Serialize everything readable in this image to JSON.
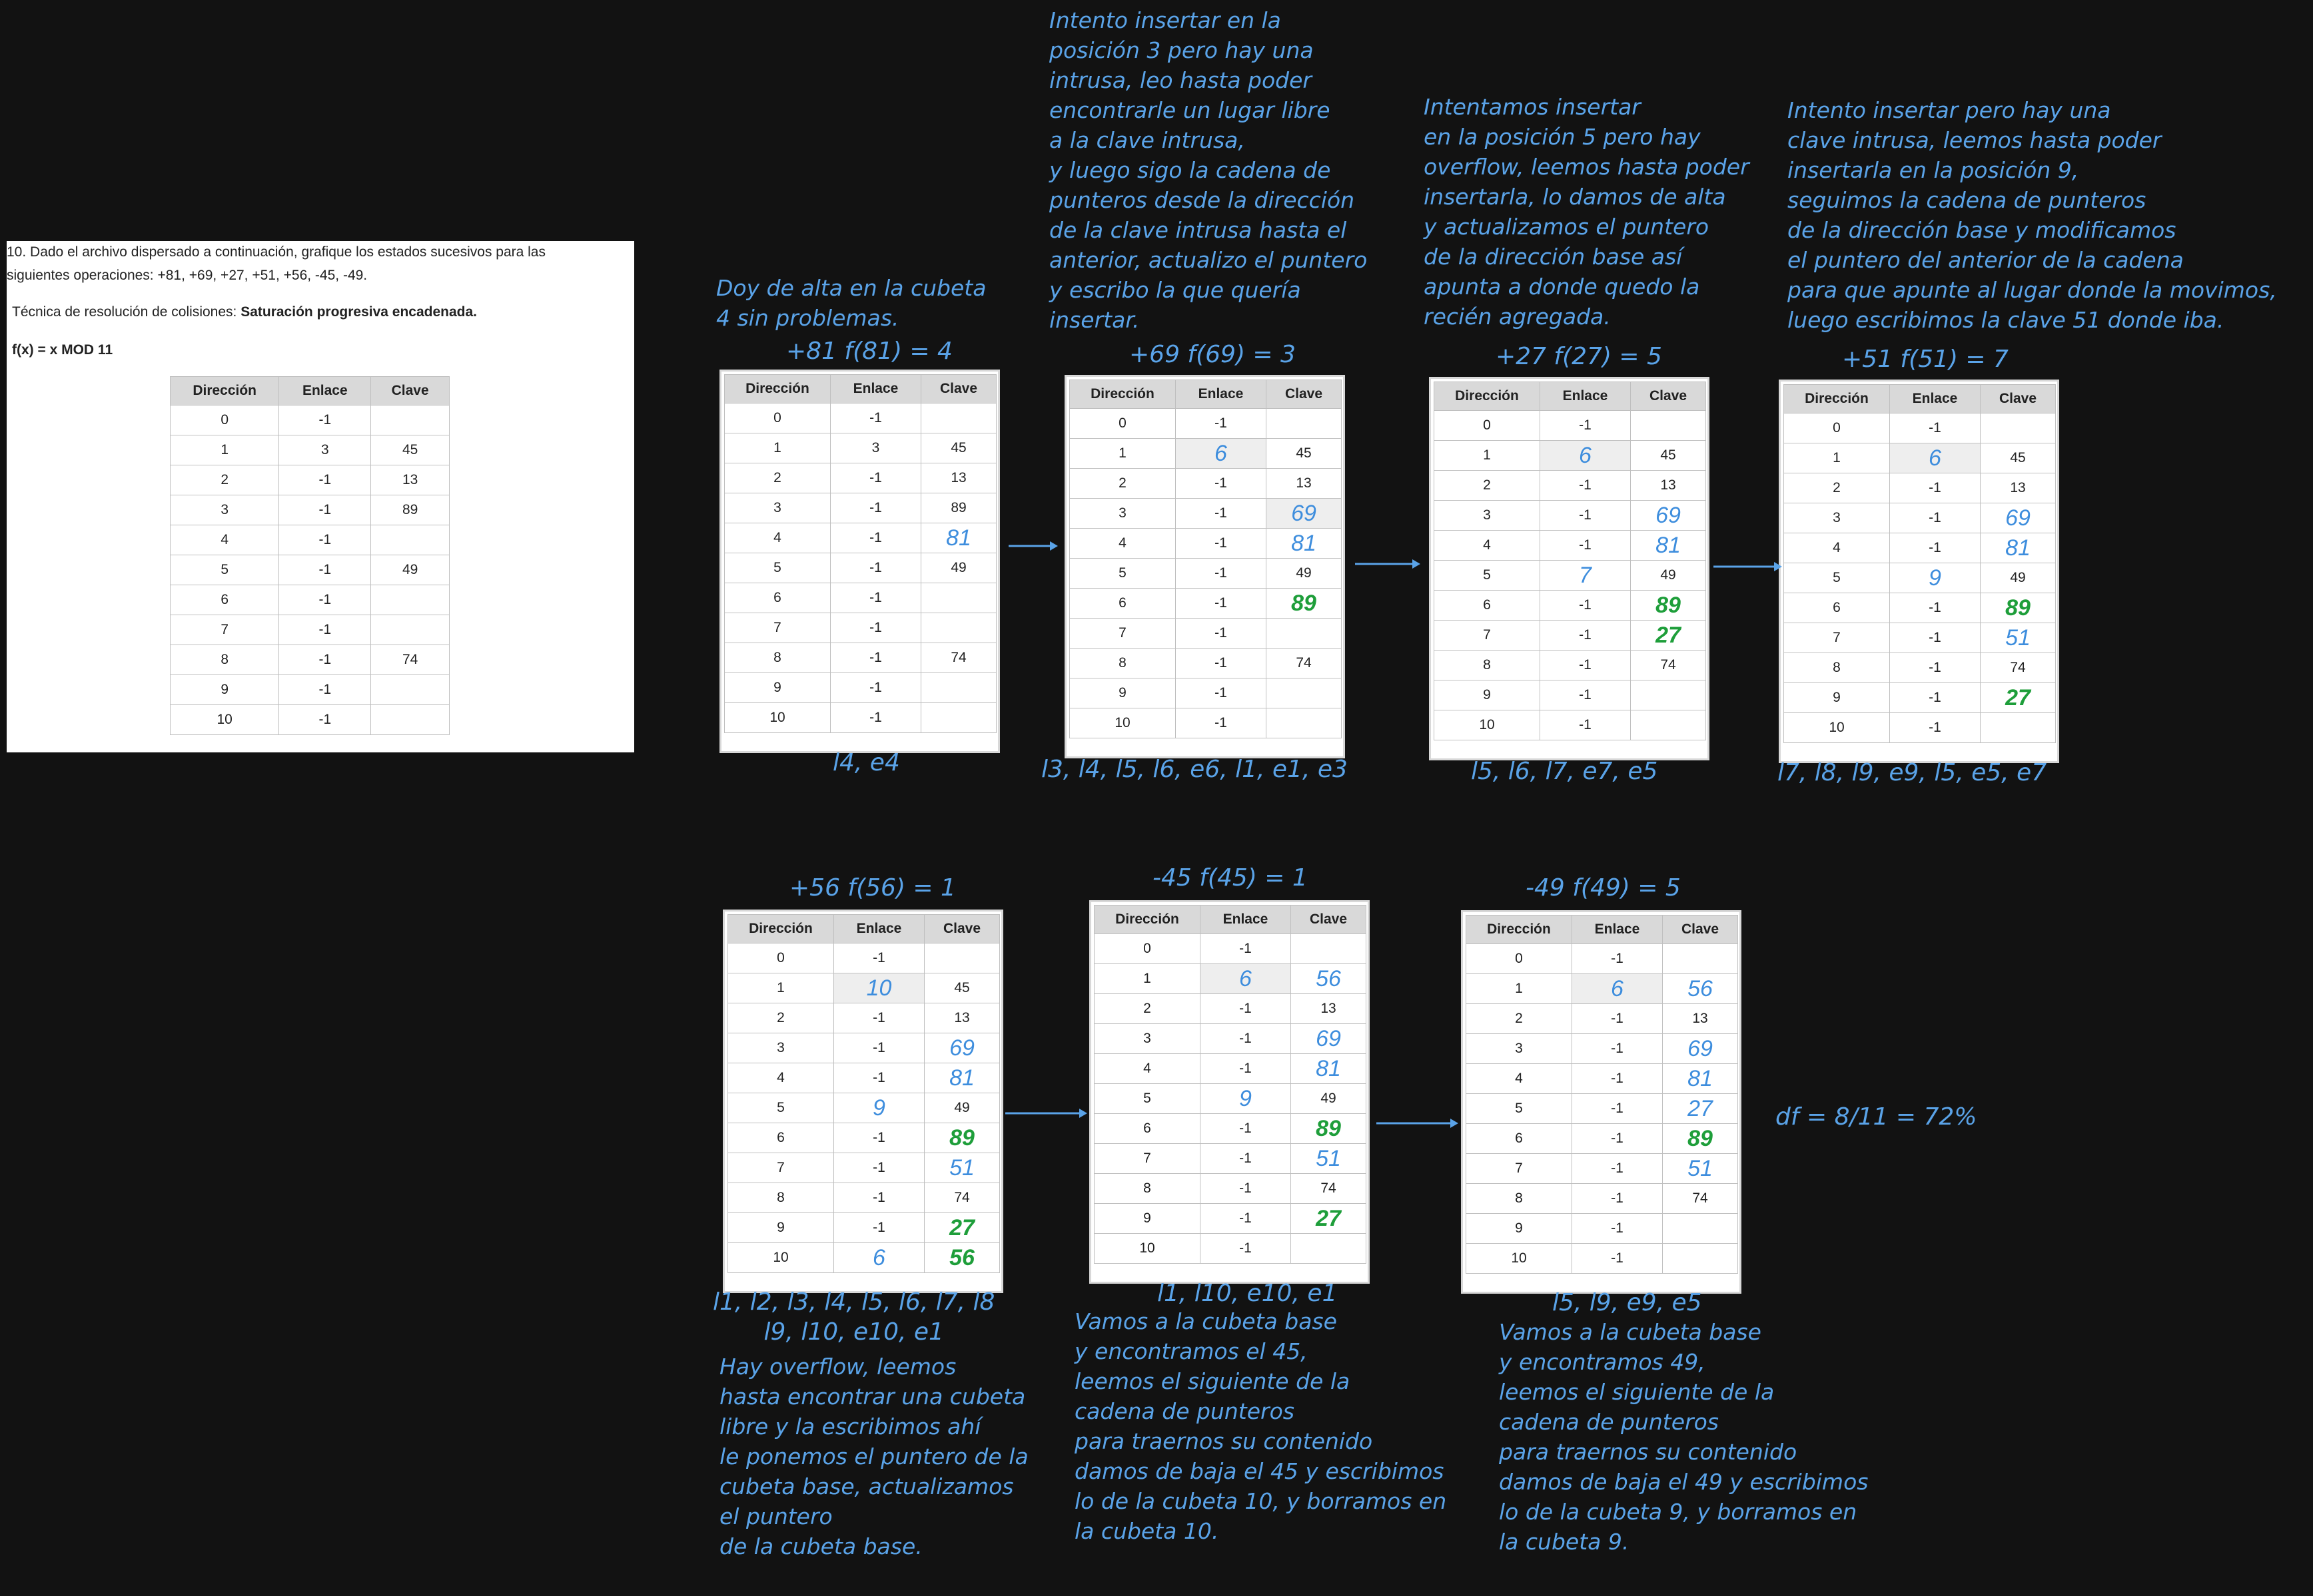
{
  "statement": {
    "line1": "10. Dado el archivo dispersado a continuación, grafique los estados sucesivos para las",
    "line2": "siguientes operaciones: +81, +69, +27, +51, +56, -45, -49.",
    "technique_label": "Técnica de resolución de colisiones: ",
    "technique_value": "Saturación progresiva encadenada.",
    "function": "f(x) = x MOD 11"
  },
  "table_headers": [
    "Dirección",
    "Enlace",
    "Clave"
  ],
  "initial_table": {
    "rows": [
      [
        "0",
        "-1",
        ""
      ],
      [
        "1",
        "3",
        "45"
      ],
      [
        "2",
        "-1",
        "13"
      ],
      [
        "3",
        "-1",
        "89"
      ],
      [
        "4",
        "-1",
        ""
      ],
      [
        "5",
        "-1",
        "49"
      ],
      [
        "6",
        "-1",
        ""
      ],
      [
        "7",
        "-1",
        ""
      ],
      [
        "8",
        "-1",
        "74"
      ],
      [
        "9",
        "-1",
        ""
      ],
      [
        "10",
        "-1",
        ""
      ]
    ]
  },
  "steps": [
    {
      "title": "+81 f(81) = 4",
      "note": "Doy de alta en la cubeta\n4 sin problemas.",
      "ops": "l4, e4",
      "rows": [
        [
          "0",
          "-1",
          ""
        ],
        [
          "1",
          "3",
          "45"
        ],
        [
          "2",
          "-1",
          "13"
        ],
        [
          "3",
          "-1",
          "89"
        ],
        [
          "4",
          "-1",
          "81"
        ],
        [
          "5",
          "-1",
          "49"
        ],
        [
          "6",
          "-1",
          ""
        ],
        [
          "7",
          "-1",
          ""
        ],
        [
          "8",
          "-1",
          "74"
        ],
        [
          "9",
          "-1",
          ""
        ],
        [
          "10",
          "-1",
          ""
        ]
      ]
    },
    {
      "title": "+69 f(69) = 3",
      "note": "Intento insertar en la\nposición 3 pero hay una\nintrusa, leo hasta poder\nencontrarle un lugar libre\na la clave intrusa,\ny luego sigo la cadena de\npunteros desde la dirección\nde la clave intrusa hasta el\nanterior, actualizo el puntero\ny escribo la que quería\ninsertar.",
      "ops": "l3, l4, l5, l6, e6, l1, e1, e3",
      "rows": [
        [
          "0",
          "-1",
          ""
        ],
        [
          "1",
          "6",
          "45"
        ],
        [
          "2",
          "-1",
          "13"
        ],
        [
          "3",
          "-1",
          "69"
        ],
        [
          "4",
          "-1",
          "81"
        ],
        [
          "5",
          "-1",
          "49"
        ],
        [
          "6",
          "-1",
          "89"
        ],
        [
          "7",
          "-1",
          ""
        ],
        [
          "8",
          "-1",
          "74"
        ],
        [
          "9",
          "-1",
          ""
        ],
        [
          "10",
          "-1",
          ""
        ]
      ]
    },
    {
      "title": "+27 f(27) = 5",
      "note": "Intentamos insertar\nen la posición 5 pero hay\noverflow, leemos hasta poder\ninsertarla, lo damos de alta\ny actualizamos el puntero\nde la dirección base así\napunta a donde quedo la\nrecién agregada.",
      "ops": "l5, l6, l7, e7, e5",
      "rows": [
        [
          "0",
          "-1",
          ""
        ],
        [
          "1",
          "6",
          "45"
        ],
        [
          "2",
          "-1",
          "13"
        ],
        [
          "3",
          "-1",
          "69"
        ],
        [
          "4",
          "-1",
          "81"
        ],
        [
          "5",
          "7",
          "49"
        ],
        [
          "6",
          "-1",
          "89"
        ],
        [
          "7",
          "-1",
          "27"
        ],
        [
          "8",
          "-1",
          "74"
        ],
        [
          "9",
          "-1",
          ""
        ],
        [
          "10",
          "-1",
          ""
        ]
      ]
    },
    {
      "title": "+51 f(51) = 7",
      "note": "Intento insertar pero hay una\nclave intrusa, leemos hasta poder\ninsertarla en la posición 9,\nseguimos la cadena de punteros\nde la dirección base y modificamos\nel puntero del anterior de la cadena\npara que apunte al lugar donde la movimos,\nluego escribimos la clave 51 donde iba.",
      "ops": "l7, l8, l9, e9, l5, e5, e7",
      "rows": [
        [
          "0",
          "-1",
          ""
        ],
        [
          "1",
          "6",
          "45"
        ],
        [
          "2",
          "-1",
          "13"
        ],
        [
          "3",
          "-1",
          "69"
        ],
        [
          "4",
          "-1",
          "81"
        ],
        [
          "5",
          "9",
          "49"
        ],
        [
          "6",
          "-1",
          "89"
        ],
        [
          "7",
          "-1",
          "51"
        ],
        [
          "8",
          "-1",
          "74"
        ],
        [
          "9",
          "-1",
          "27"
        ],
        [
          "10",
          "-1",
          ""
        ]
      ]
    },
    {
      "title": "+56 f(56) = 1",
      "note": "Hay overflow, leemos\nhasta encontrar una cubeta\nlibre y la escribimos ahí\nle ponemos el puntero de la\ncubeta base, actualizamos\nel puntero\nde la cubeta base.",
      "ops": "l1, l2, l3, l4, l5, l6, l7, l8\nl9, l10, e10, e1",
      "rows": [
        [
          "0",
          "-1",
          ""
        ],
        [
          "1",
          "10",
          "45"
        ],
        [
          "2",
          "-1",
          "13"
        ],
        [
          "3",
          "-1",
          "69"
        ],
        [
          "4",
          "-1",
          "81"
        ],
        [
          "5",
          "9",
          "49"
        ],
        [
          "6",
          "-1",
          "89"
        ],
        [
          "7",
          "-1",
          "51"
        ],
        [
          "8",
          "-1",
          "74"
        ],
        [
          "9",
          "-1",
          "27"
        ],
        [
          "10",
          "6",
          "56"
        ]
      ]
    },
    {
      "title": "-45 f(45) = 1",
      "note": "Vamos a la cubeta base\ny encontramos el 45,\nleemos el siguiente de la\ncadena de punteros\npara traernos su contenido\ndamos de baja el 45 y escribimos\nlo de la cubeta 10, y borramos en\nla cubeta 10.",
      "ops": "l1, l10, e10, e1",
      "rows": [
        [
          "0",
          "-1",
          ""
        ],
        [
          "1",
          "6",
          "56"
        ],
        [
          "2",
          "-1",
          "13"
        ],
        [
          "3",
          "-1",
          "69"
        ],
        [
          "4",
          "-1",
          "81"
        ],
        [
          "5",
          "9",
          "49"
        ],
        [
          "6",
          "-1",
          "89"
        ],
        [
          "7",
          "-1",
          "51"
        ],
        [
          "8",
          "-1",
          "74"
        ],
        [
          "9",
          "-1",
          "27"
        ],
        [
          "10",
          "-1",
          ""
        ]
      ]
    },
    {
      "title": "-49 f(49) = 5",
      "note": "Vamos a la cubeta base\ny encontramos 49,\nleemos el siguiente de la\ncadena de punteros\npara traernos su contenido\ndamos de baja el 49 y escribimos\nlo de la cubeta 9, y borramos en\nla cubeta 9.",
      "ops": "l5, l9, e9, e5",
      "rows": [
        [
          "0",
          "-1",
          ""
        ],
        [
          "1",
          "6",
          "56"
        ],
        [
          "2",
          "-1",
          "13"
        ],
        [
          "3",
          "-1",
          "69"
        ],
        [
          "4",
          "-1",
          "81"
        ],
        [
          "5",
          "-1",
          "27"
        ],
        [
          "6",
          "-1",
          "89"
        ],
        [
          "7",
          "-1",
          "51"
        ],
        [
          "8",
          "-1",
          "74"
        ],
        [
          "9",
          "-1",
          ""
        ],
        [
          "10",
          "-1",
          ""
        ]
      ]
    }
  ],
  "density": "df = 8/11 = 72%",
  "colors": {
    "background": "#121212",
    "handwriting": "#5aa3e8",
    "green": "#1e9e3a"
  }
}
